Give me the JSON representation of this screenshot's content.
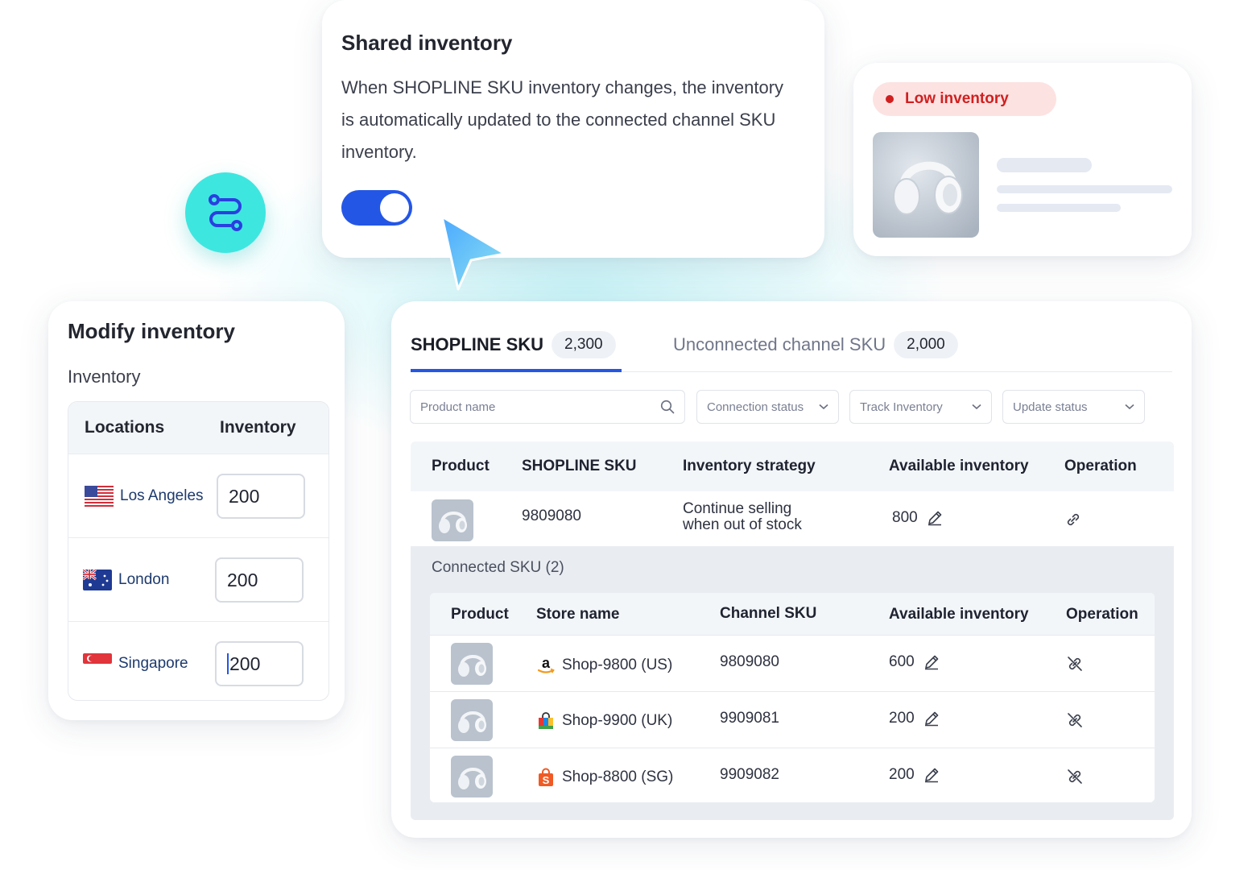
{
  "shared_inventory": {
    "title": "Shared inventory",
    "description": "When SHOPLINE SKU inventory changes, the inventory is automatically updated to the connected channel SKU inventory.",
    "toggle_on": true
  },
  "low_inventory": {
    "badge": "Low inventory",
    "badge_color": "#d11f1f"
  },
  "modify_inventory": {
    "title": "Modify inventory",
    "subtitle": "Inventory",
    "columns": [
      "Locations",
      "Inventory"
    ],
    "rows": [
      {
        "location": "Los Angeles",
        "flag": "us-flag-icon",
        "value": "200"
      },
      {
        "location": "London",
        "flag": "au-flag-icon",
        "value": "200"
      },
      {
        "location": "Singapore",
        "flag": "sg-flag-icon",
        "value": "200"
      }
    ]
  },
  "sku_panel": {
    "tabs": [
      {
        "label": "SHOPLINE SKU",
        "count": "2,300",
        "active": true
      },
      {
        "label": "Unconnected channel SKU",
        "count": "2,000",
        "active": false
      }
    ],
    "filters": {
      "search_placeholder": "Product name",
      "connection_status": "Connection status",
      "track_inventory": "Track Inventory",
      "update_status": "Update status"
    },
    "columns": [
      "Product",
      "SHOPLINE SKU",
      "Inventory strategy",
      "Available inventory",
      "Operation"
    ],
    "row": {
      "sku": "9809080",
      "strategy_line1": "Continue selling",
      "strategy_line2": "when out of stock",
      "available": "800"
    },
    "connected_label": "Connected SKU (2)",
    "connected_columns": [
      "Product",
      "Store name",
      "Channel SKU",
      "Available inventory",
      "Operation"
    ],
    "connected_rows": [
      {
        "store": "Shop-9800 (US)",
        "store_icon": "amazon-icon",
        "sku": "9809080",
        "available": "600"
      },
      {
        "store": "Shop-9900 (UK)",
        "store_icon": "shopping-bag-icon",
        "sku": "9909081",
        "available": "200"
      },
      {
        "store": "Shop-8800 (SG)",
        "store_icon": "shopee-icon",
        "sku": "9909082",
        "available": "200"
      }
    ]
  },
  "colors": {
    "accent": "#2456e6",
    "teal": "#3ee6e0",
    "badge_bg": "#fde2e2"
  }
}
